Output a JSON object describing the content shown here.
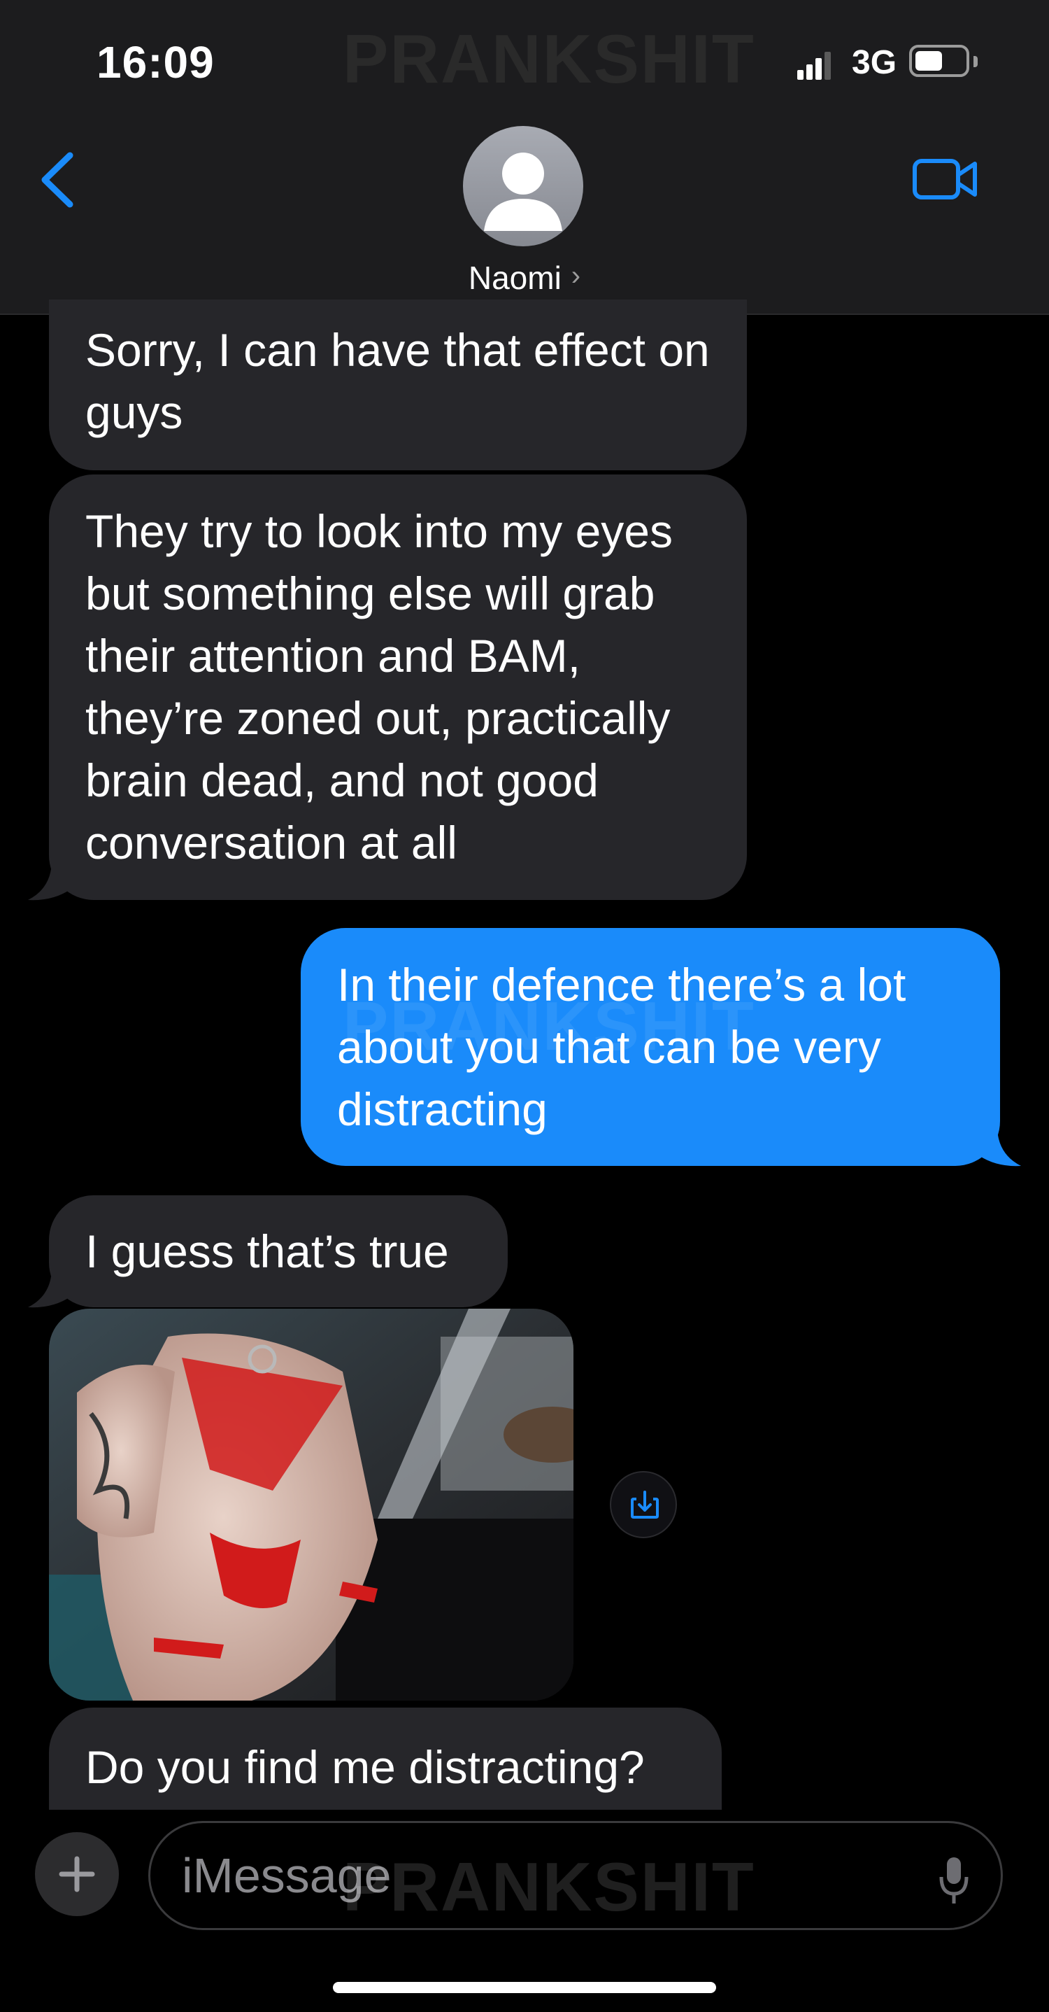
{
  "status_bar": {
    "time": "16:09",
    "network": "3G",
    "watermark": "PRANKSHIT"
  },
  "header": {
    "contact_name": "Naomi",
    "chevron": "›"
  },
  "icons": {
    "back": "chevron-left-icon",
    "avatar": "person-silhouette-icon",
    "video": "video-camera-icon",
    "save": "download-icon",
    "plus": "plus-icon",
    "mic": "microphone-icon"
  },
  "colors": {
    "incoming_bubble": "#26262a",
    "outgoing_bubble": "#1a8bfa",
    "accent": "#1a8bfa"
  },
  "messages": [
    {
      "direction": "incoming",
      "text": "Sorry, I can have that effect on guys"
    },
    {
      "direction": "incoming",
      "text": "They try to look into my eyes but something else will grab their attention and BAM, they’re zoned out, practically brain dead, and not good conversation at all"
    },
    {
      "direction": "outgoing",
      "text": "In their defence there’s a lot about you that can be very distracting"
    },
    {
      "direction": "incoming",
      "text": "I guess that’s true"
    },
    {
      "direction": "incoming",
      "type": "photo"
    },
    {
      "direction": "incoming",
      "text": "Do you find me distracting?"
    }
  ],
  "watermark_mid": "PRANKSHIT",
  "composer": {
    "placeholder": "iMessage",
    "watermark": "PRANKSHIT"
  }
}
